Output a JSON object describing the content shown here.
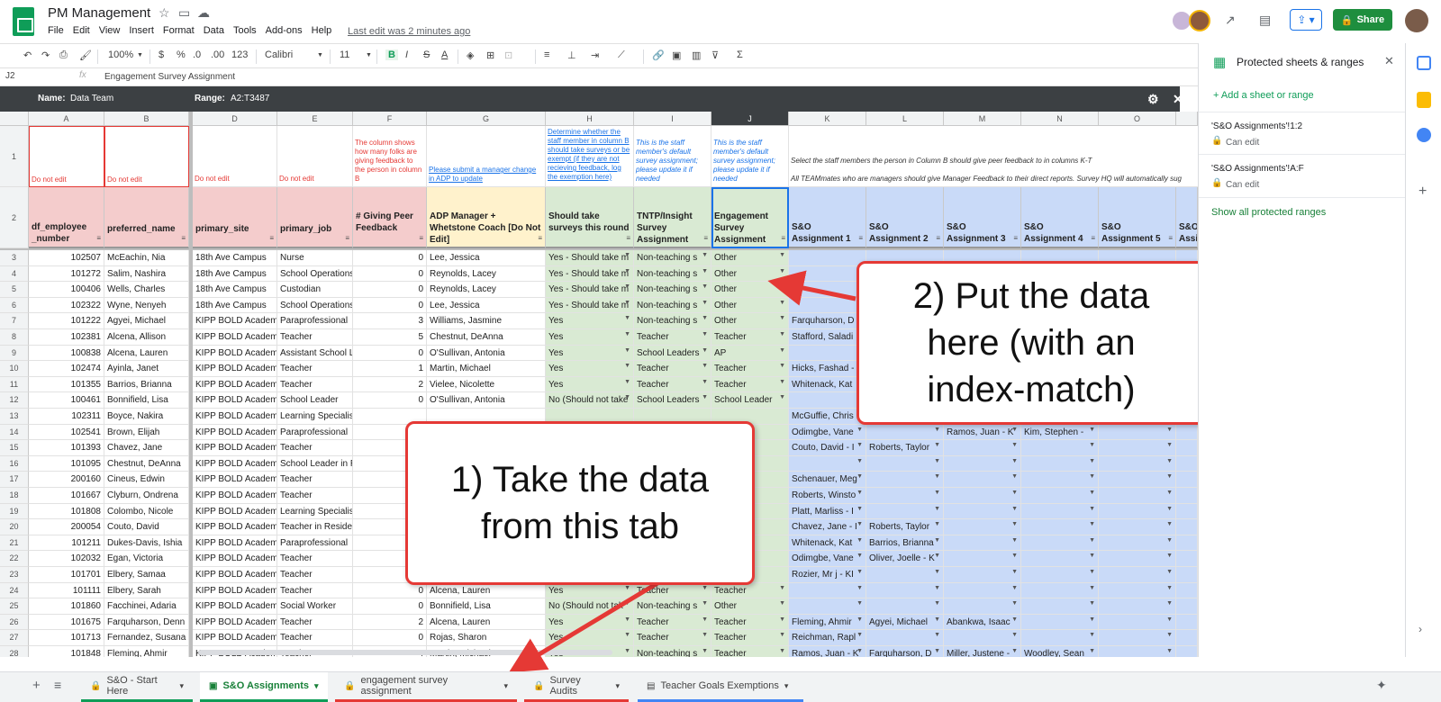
{
  "app": {
    "title": "PM Management",
    "menu": [
      "File",
      "Edit",
      "View",
      "Insert",
      "Format",
      "Data",
      "Tools",
      "Add-ons",
      "Help"
    ],
    "last_edit": "Last edit was 2 minutes ago",
    "share_label": "Share"
  },
  "toolbar": {
    "zoom": "100%",
    "currency": "$",
    "percent": "%",
    "dec_less": ".0",
    "dec_more": ".00",
    "format_more": "123",
    "font": "Calibri",
    "font_size": "11",
    "bold": "B",
    "italic": "I",
    "strike": "S",
    "text_color": "A"
  },
  "formula_bar": {
    "cell_ref": "J2",
    "fx": "fx",
    "value": "Engagement Survey Assignment"
  },
  "protected_bar": {
    "name_label": "Name:",
    "name_value": "Data Team",
    "range_label": "Range:",
    "range_value": "A2:T3487"
  },
  "grid": {
    "columns": [
      "A",
      "B",
      "D",
      "E",
      "F",
      "G",
      "H",
      "I",
      "J",
      "K",
      "L",
      "M",
      "N",
      "O"
    ],
    "row1_notes": {
      "A": "Do not edit",
      "B": "Do not edit",
      "D": "Do not edit",
      "E": "Do not edit",
      "F": "The column shows how many folks are giving feedback to the person in column B",
      "G": "Please submit a manager change in ADP to update",
      "H": "Determine whether the staff member in column B should take surveys or be exempt (if they are not recieving feedback, log the exemption here)",
      "I": "This is the staff member's default survey assignment; please update it if needed",
      "J": "This is the staff member's default survey assignment; please update it if needed",
      "K": "Select the staff members the person in Column B should give peer feedback to in columns K-T",
      "K2": "All TEAMmates who are managers should give Manager Feedback to their direct reports. Survey HQ will automatically sug"
    },
    "headers": {
      "A": "df_employee _number",
      "B": "preferred_name",
      "D": "primary_site",
      "E": "primary_job",
      "F": "# Giving Peer Feedback",
      "G": "ADP Manager + Whetstone Coach [Do Not Edit]",
      "H": "Should take surveys this round",
      "I": "TNTP/Insight Survey Assignment",
      "J": "Engagement Survey Assignment",
      "K": "S&O Assignment 1",
      "L": "S&O Assignment 2",
      "M": "S&O Assignment 3",
      "N": "S&O Assignment 4",
      "O": "S&O Assignment 5",
      "P": "S&O Assi"
    },
    "rows": [
      {
        "n": "3",
        "A": "102507",
        "B": "McEachin, Nia",
        "D": "18th Ave Campus",
        "E": "Nurse",
        "F": "0",
        "G": "Lee, Jessica",
        "H": "Yes - Should take m",
        "I": "Non-teaching s",
        "J": "Other",
        "K": "",
        "L": "",
        "M": "",
        "N": "",
        "O": ""
      },
      {
        "n": "4",
        "A": "101272",
        "B": "Salim, Nashira",
        "D": "18th Ave Campus",
        "E": "School Operations",
        "F": "0",
        "G": "Reynolds, Lacey",
        "H": "Yes - Should take m",
        "I": "Non-teaching s",
        "J": "Other",
        "K": "",
        "L": "",
        "M": "",
        "N": "",
        "O": ""
      },
      {
        "n": "5",
        "A": "100406",
        "B": "Wells, Charles",
        "D": "18th Ave Campus",
        "E": "Custodian",
        "F": "0",
        "G": "Reynolds, Lacey",
        "H": "Yes - Should take m",
        "I": "Non-teaching s",
        "J": "Other",
        "K": "",
        "L": "",
        "M": "",
        "N": "",
        "O": ""
      },
      {
        "n": "6",
        "A": "102322",
        "B": "Wyne, Nenyeh",
        "D": "18th Ave Campus",
        "E": "School Operations",
        "F": "0",
        "G": "Lee, Jessica",
        "H": "Yes - Should take m",
        "I": "Non-teaching s",
        "J": "Other",
        "K": "",
        "L": "",
        "M": "",
        "N": "",
        "O": ""
      },
      {
        "n": "7",
        "A": "101222",
        "B": "Agyei, Michael",
        "D": "KIPP BOLD Academy",
        "E": "Paraprofessional",
        "F": "3",
        "G": "Williams, Jasmine",
        "H": "Yes",
        "I": "Non-teaching s",
        "J": "Other",
        "K": "Farquharson, D",
        "L": "",
        "M": "",
        "N": "",
        "O": ""
      },
      {
        "n": "8",
        "A": "102381",
        "B": "Alcena, Allison",
        "D": "KIPP BOLD Academy",
        "E": "Teacher",
        "F": "5",
        "G": "Chestnut, DeAnna",
        "H": "Yes",
        "I": "Teacher",
        "J": "Teacher",
        "K": "Stafford, Saladi",
        "L": "",
        "M": "",
        "N": "",
        "O": ""
      },
      {
        "n": "9",
        "A": "100838",
        "B": "Alcena, Lauren",
        "D": "KIPP BOLD Academy",
        "E": "Assistant School L",
        "F": "0",
        "G": "O'Sullivan, Antonia",
        "H": "Yes",
        "I": "School Leaders",
        "J": "AP",
        "K": "",
        "L": "",
        "M": "",
        "N": "",
        "O": ""
      },
      {
        "n": "10",
        "A": "102474",
        "B": "Ayinla, Janet",
        "D": "KIPP BOLD Academy",
        "E": "Teacher",
        "F": "1",
        "G": "Martin, Michael",
        "H": "Yes",
        "I": "Teacher",
        "J": "Teacher",
        "K": "Hicks, Fashad -",
        "L": "",
        "M": "",
        "N": "",
        "O": ""
      },
      {
        "n": "11",
        "A": "101355",
        "B": "Barrios, Brianna",
        "D": "KIPP BOLD Academy",
        "E": "Teacher",
        "F": "2",
        "G": "Vielee, Nicolette",
        "H": "Yes",
        "I": "Teacher",
        "J": "Teacher",
        "K": "Whitenack, Kat",
        "L": "",
        "M": "",
        "N": "",
        "O": ""
      },
      {
        "n": "12",
        "A": "100461",
        "B": "Bonnifield, Lisa",
        "D": "KIPP BOLD Academy",
        "E": "School Leader",
        "F": "0",
        "G": "O'Sullivan, Antonia",
        "H": "No (Should not take",
        "I": "School Leaders",
        "J": "School Leader",
        "K": "",
        "L": "",
        "M": "",
        "N": "",
        "O": ""
      },
      {
        "n": "13",
        "A": "102311",
        "B": "Boyce, Nakira",
        "D": "KIPP BOLD Academy",
        "E": "Learning Specialis",
        "F": "",
        "G": "",
        "H": "",
        "I": "",
        "J": "",
        "K": "McGuffie, Chris",
        "L": "",
        "M": "",
        "N": "",
        "O": ""
      },
      {
        "n": "14",
        "A": "102541",
        "B": "Brown, Elijah",
        "D": "KIPP BOLD Academy",
        "E": "Paraprofessional",
        "F": "",
        "G": "",
        "H": "",
        "I": "",
        "J": "",
        "K": "Odimgbe, Vane",
        "L": "",
        "M": "Ramos, Juan - K",
        "N": "Kim, Stephen -",
        "O": ""
      },
      {
        "n": "15",
        "A": "101393",
        "B": "Chavez, Jane",
        "D": "KIPP BOLD Academy",
        "E": "Teacher",
        "F": "",
        "G": "",
        "H": "",
        "I": "",
        "J": "",
        "K": "Couto, David - I",
        "L": "Roberts, Taylor",
        "M": "",
        "N": "",
        "O": ""
      },
      {
        "n": "16",
        "A": "101095",
        "B": "Chestnut, DeAnna",
        "D": "KIPP BOLD Academy",
        "E": "School Leader in R",
        "F": "",
        "G": "",
        "H": "",
        "I": "",
        "J": "",
        "K": "",
        "L": "",
        "M": "",
        "N": "",
        "O": ""
      },
      {
        "n": "17",
        "A": "200160",
        "B": "Cineus, Edwin",
        "D": "KIPP BOLD Academy",
        "E": "Teacher",
        "F": "",
        "G": "",
        "H": "",
        "I": "",
        "J": "",
        "K": "Schenauer, Meg",
        "L": "",
        "M": "",
        "N": "",
        "O": ""
      },
      {
        "n": "18",
        "A": "101667",
        "B": "Clyburn, Ondrena",
        "D": "KIPP BOLD Academy",
        "E": "Teacher",
        "F": "",
        "G": "",
        "H": "",
        "I": "",
        "J": "",
        "K": "Roberts, Winsto",
        "L": "",
        "M": "",
        "N": "",
        "O": ""
      },
      {
        "n": "19",
        "A": "101808",
        "B": "Colombo, Nicole",
        "D": "KIPP BOLD Academy",
        "E": "Learning Specialis",
        "F": "",
        "G": "",
        "H": "",
        "I": "",
        "J": "",
        "K": "Platt, Marliss - I",
        "L": "",
        "M": "",
        "N": "",
        "O": ""
      },
      {
        "n": "20",
        "A": "200054",
        "B": "Couto, David",
        "D": "KIPP BOLD Academy",
        "E": "Teacher in Reside",
        "F": "",
        "G": "",
        "H": "",
        "I": "",
        "J": "",
        "K": "Chavez, Jane - I",
        "L": "Roberts, Taylor",
        "M": "",
        "N": "",
        "O": ""
      },
      {
        "n": "21",
        "A": "101211",
        "B": "Dukes-Davis, Ishia",
        "D": "KIPP BOLD Academy",
        "E": "Paraprofessional",
        "F": "",
        "G": "",
        "H": "",
        "I": "",
        "J": "",
        "K": "Whitenack, Kat",
        "L": "Barrios, Brianna",
        "M": "",
        "N": "",
        "O": ""
      },
      {
        "n": "22",
        "A": "102032",
        "B": "Egan, Victoria",
        "D": "KIPP BOLD Academy",
        "E": "Teacher",
        "F": "",
        "G": "",
        "H": "",
        "I": "",
        "J": "",
        "K": "Odimgbe, Vane",
        "L": "Oliver, Joelle - K",
        "M": "",
        "N": "",
        "O": ""
      },
      {
        "n": "23",
        "A": "101701",
        "B": "Elbery, Samaa",
        "D": "KIPP BOLD Academy",
        "E": "Teacher",
        "F": "",
        "G": "",
        "H": "",
        "I": "",
        "J": "",
        "K": "Rozier, Mr j - KI",
        "L": "",
        "M": "",
        "N": "",
        "O": ""
      },
      {
        "n": "24",
        "A": "101111",
        "B": "Elbery, Sarah",
        "D": "KIPP BOLD Academy",
        "E": "Teacher",
        "F": "0",
        "G": "Alcena, Lauren",
        "H": "Yes",
        "I": "Teacher",
        "J": "Teacher",
        "K": "",
        "L": "",
        "M": "",
        "N": "",
        "O": ""
      },
      {
        "n": "25",
        "A": "101860",
        "B": "Facchinei, Adaria",
        "D": "KIPP BOLD Academy",
        "E": "Social Worker",
        "F": "0",
        "G": "Bonnifield, Lisa",
        "H": "No (Should not tak",
        "I": "Non-teaching s",
        "J": "Other",
        "K": "",
        "L": "",
        "M": "",
        "N": "",
        "O": ""
      },
      {
        "n": "26",
        "A": "101675",
        "B": "Farquharson, Denn",
        "D": "KIPP BOLD Academy",
        "E": "Teacher",
        "F": "2",
        "G": "Alcena, Lauren",
        "H": "Yes",
        "I": "Teacher",
        "J": "Teacher",
        "K": "Fleming, Ahmir",
        "L": "Agyei, Michael",
        "M": "Abankwa, Isaac",
        "N": "",
        "O": ""
      },
      {
        "n": "27",
        "A": "101713",
        "B": "Fernandez, Susana",
        "D": "KIPP BOLD Academy",
        "E": "Teacher",
        "F": "0",
        "G": "Rojas, Sharon",
        "H": "Yes",
        "I": "Teacher",
        "J": "Teacher",
        "K": "Reichman, Rapl",
        "L": "",
        "M": "",
        "N": "",
        "O": ""
      },
      {
        "n": "28",
        "A": "101848",
        "B": "Fleming, Ahmir",
        "D": "KIPP BOLD Academy",
        "E": "Teacher",
        "F": "4",
        "G": "Martin, Michael",
        "H": "Yes",
        "I": "Non-teaching s",
        "J": "Teacher",
        "K": "Ramos, Juan - K",
        "L": "Farquharson, D",
        "M": "Miller, Justene -",
        "N": "Woodley, Sean",
        "O": ""
      }
    ]
  },
  "callouts": {
    "one": "1) Take the data from this tab",
    "two": "2) Put the data here (with an index-match)"
  },
  "side_panel": {
    "title": "Protected sheets & ranges",
    "add": "+ Add a sheet or range",
    "items": [
      {
        "name": "'S&O Assignments'!1:2",
        "sub": "Can edit"
      },
      {
        "name": "'S&O Assignments'!A:F",
        "sub": "Can edit"
      }
    ],
    "show_all": "Show all protected ranges"
  },
  "tabs": [
    {
      "label": "S&O - Start Here",
      "color": "#0f9d58"
    },
    {
      "label": "S&O Assignments",
      "color": "#0f9d58"
    },
    {
      "label": "engagement survey assignment",
      "color": "#e53935"
    },
    {
      "label": "Survey Audits",
      "color": "#e53935"
    },
    {
      "label": "Teacher Goals Exemptions",
      "color": "#4285f4"
    }
  ],
  "colors": {
    "pink": "#f4cccc",
    "yellow": "#fff2cc",
    "green": "#d9ead3",
    "blue": "#c9daf8",
    "callout_border": "#e53935",
    "brand_green": "#0f9d58"
  }
}
